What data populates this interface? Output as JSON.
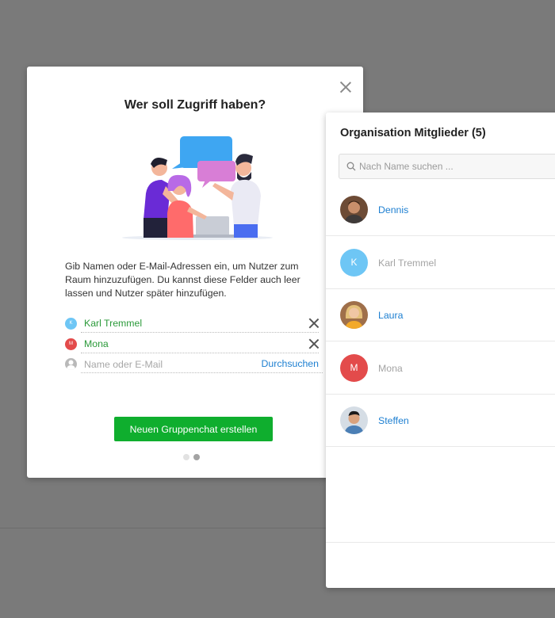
{
  "modal": {
    "title": "Wer soll Zugriff haben?",
    "description": "Gib Namen oder E-Mail-Adressen ein, um Nutzer zum Raum hinzuzufügen. Du kannst diese Felder auch leer lassen und Nutzer später hinzufügen.",
    "invitees": [
      {
        "name": "Karl Tremmel",
        "initial": "K",
        "color": "#6ec6f5"
      },
      {
        "name": "Mona",
        "initial": "M",
        "color": "#e34b4b"
      }
    ],
    "input_placeholder": "Name oder E-Mail",
    "browse_label": "Durchsuchen",
    "create_button": "Neuen Gruppenchat erstellen",
    "pager": {
      "pages": 2,
      "active": 2
    }
  },
  "members_panel": {
    "title": "Organisation Mitglieder (5)",
    "search_placeholder": "Nach Name suchen ...",
    "members": [
      {
        "name": "Dennis",
        "type": "photo",
        "active": true
      },
      {
        "name": "Karl Tremmel",
        "initial": "K",
        "color": "#6ec6f5",
        "active": false
      },
      {
        "name": "Laura",
        "type": "photo",
        "active": true
      },
      {
        "name": "Mona",
        "initial": "M",
        "color": "#e34b4b",
        "active": false
      },
      {
        "name": "Steffen",
        "type": "photo",
        "active": true
      }
    ]
  },
  "colors": {
    "accent": "#0fae2e",
    "link": "#1d7fd1",
    "invitee_text": "#2b9a3a"
  }
}
